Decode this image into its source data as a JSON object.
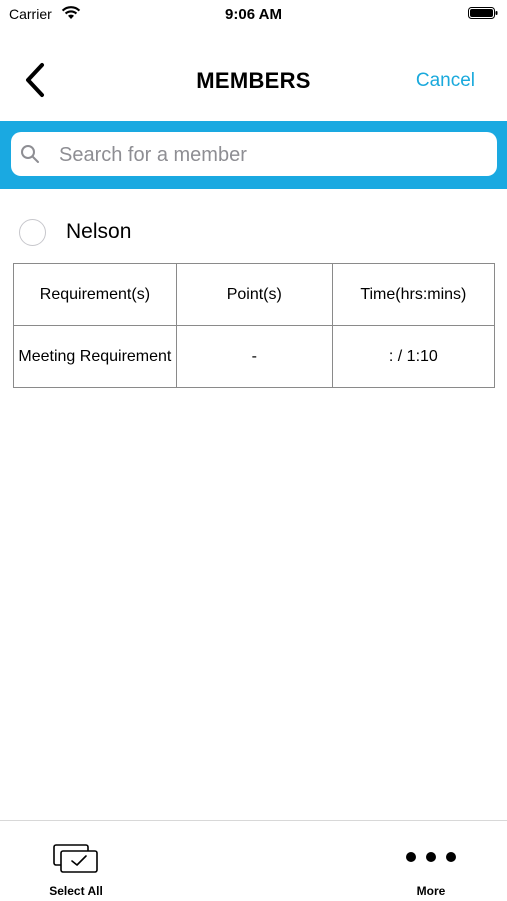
{
  "status_bar": {
    "carrier": "Carrier",
    "time": "9:06 AM"
  },
  "nav": {
    "title": "MEMBERS",
    "cancel_label": "Cancel",
    "back_icon": "chevron-left-icon"
  },
  "search": {
    "placeholder": "Search for a member",
    "value": ""
  },
  "member": {
    "name": "Nelson",
    "selected": false
  },
  "table": {
    "headers": [
      "Requirement(s)",
      "Point(s)",
      "Time(hrs:mins)"
    ],
    "rows": [
      [
        "Meeting Requirement",
        "-",
        ": / 1:10"
      ]
    ]
  },
  "tab_bar": {
    "items": [
      {
        "label": "Select All",
        "icon": "select-all-icon"
      },
      {
        "label": "More",
        "icon": "more-icon"
      }
    ]
  },
  "colors": {
    "accent": "#1aa9e1",
    "cancel_text": "#1aa9dc"
  }
}
